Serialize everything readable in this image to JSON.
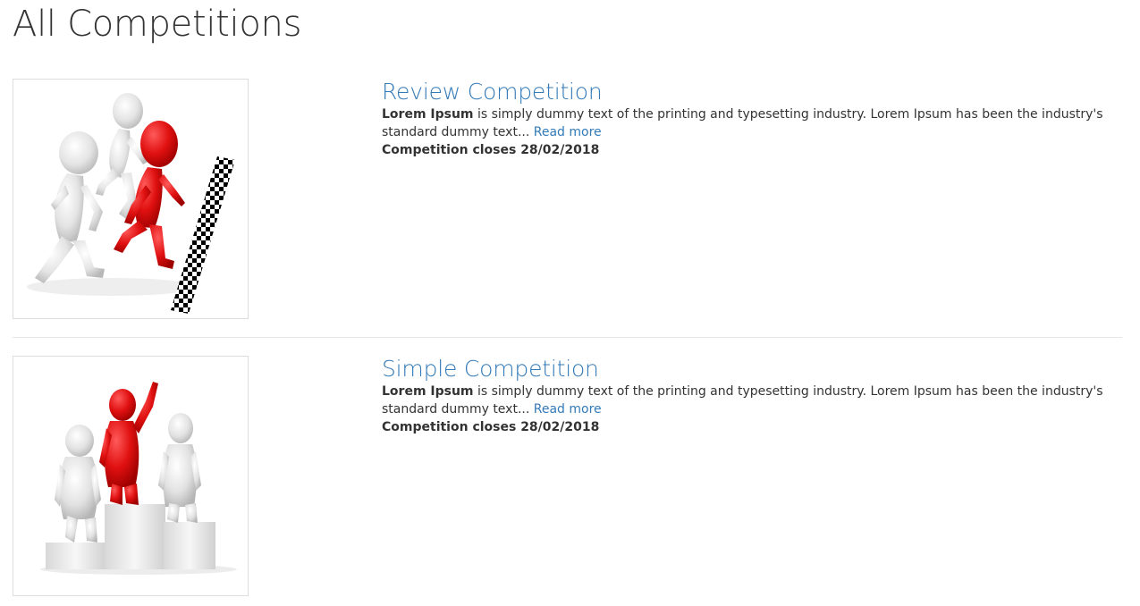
{
  "page": {
    "title": "All Competitions"
  },
  "competitions": [
    {
      "title": "Review Competition",
      "image_icon": "runners-race-finish-line-illustration",
      "desc_bold": "Lorem Ipsum",
      "desc_text": " is simply dummy text of the printing and typesetting industry. Lorem Ipsum has been the industry's standard dummy text... ",
      "read_more": "Read more",
      "closes": "Competition closes 28/02/2018"
    },
    {
      "title": "Simple Competition",
      "image_icon": "winners-podium-illustration",
      "desc_bold": "Lorem Ipsum",
      "desc_text": " is simply dummy text of the printing and typesetting industry. Lorem Ipsum has been the industry's standard dummy text... ",
      "read_more": "Read more",
      "closes": "Competition closes 28/02/2018"
    }
  ],
  "colors": {
    "link": "#337ab7",
    "text": "#333333",
    "accent_red": "#e01010",
    "border": "#dddddd"
  }
}
